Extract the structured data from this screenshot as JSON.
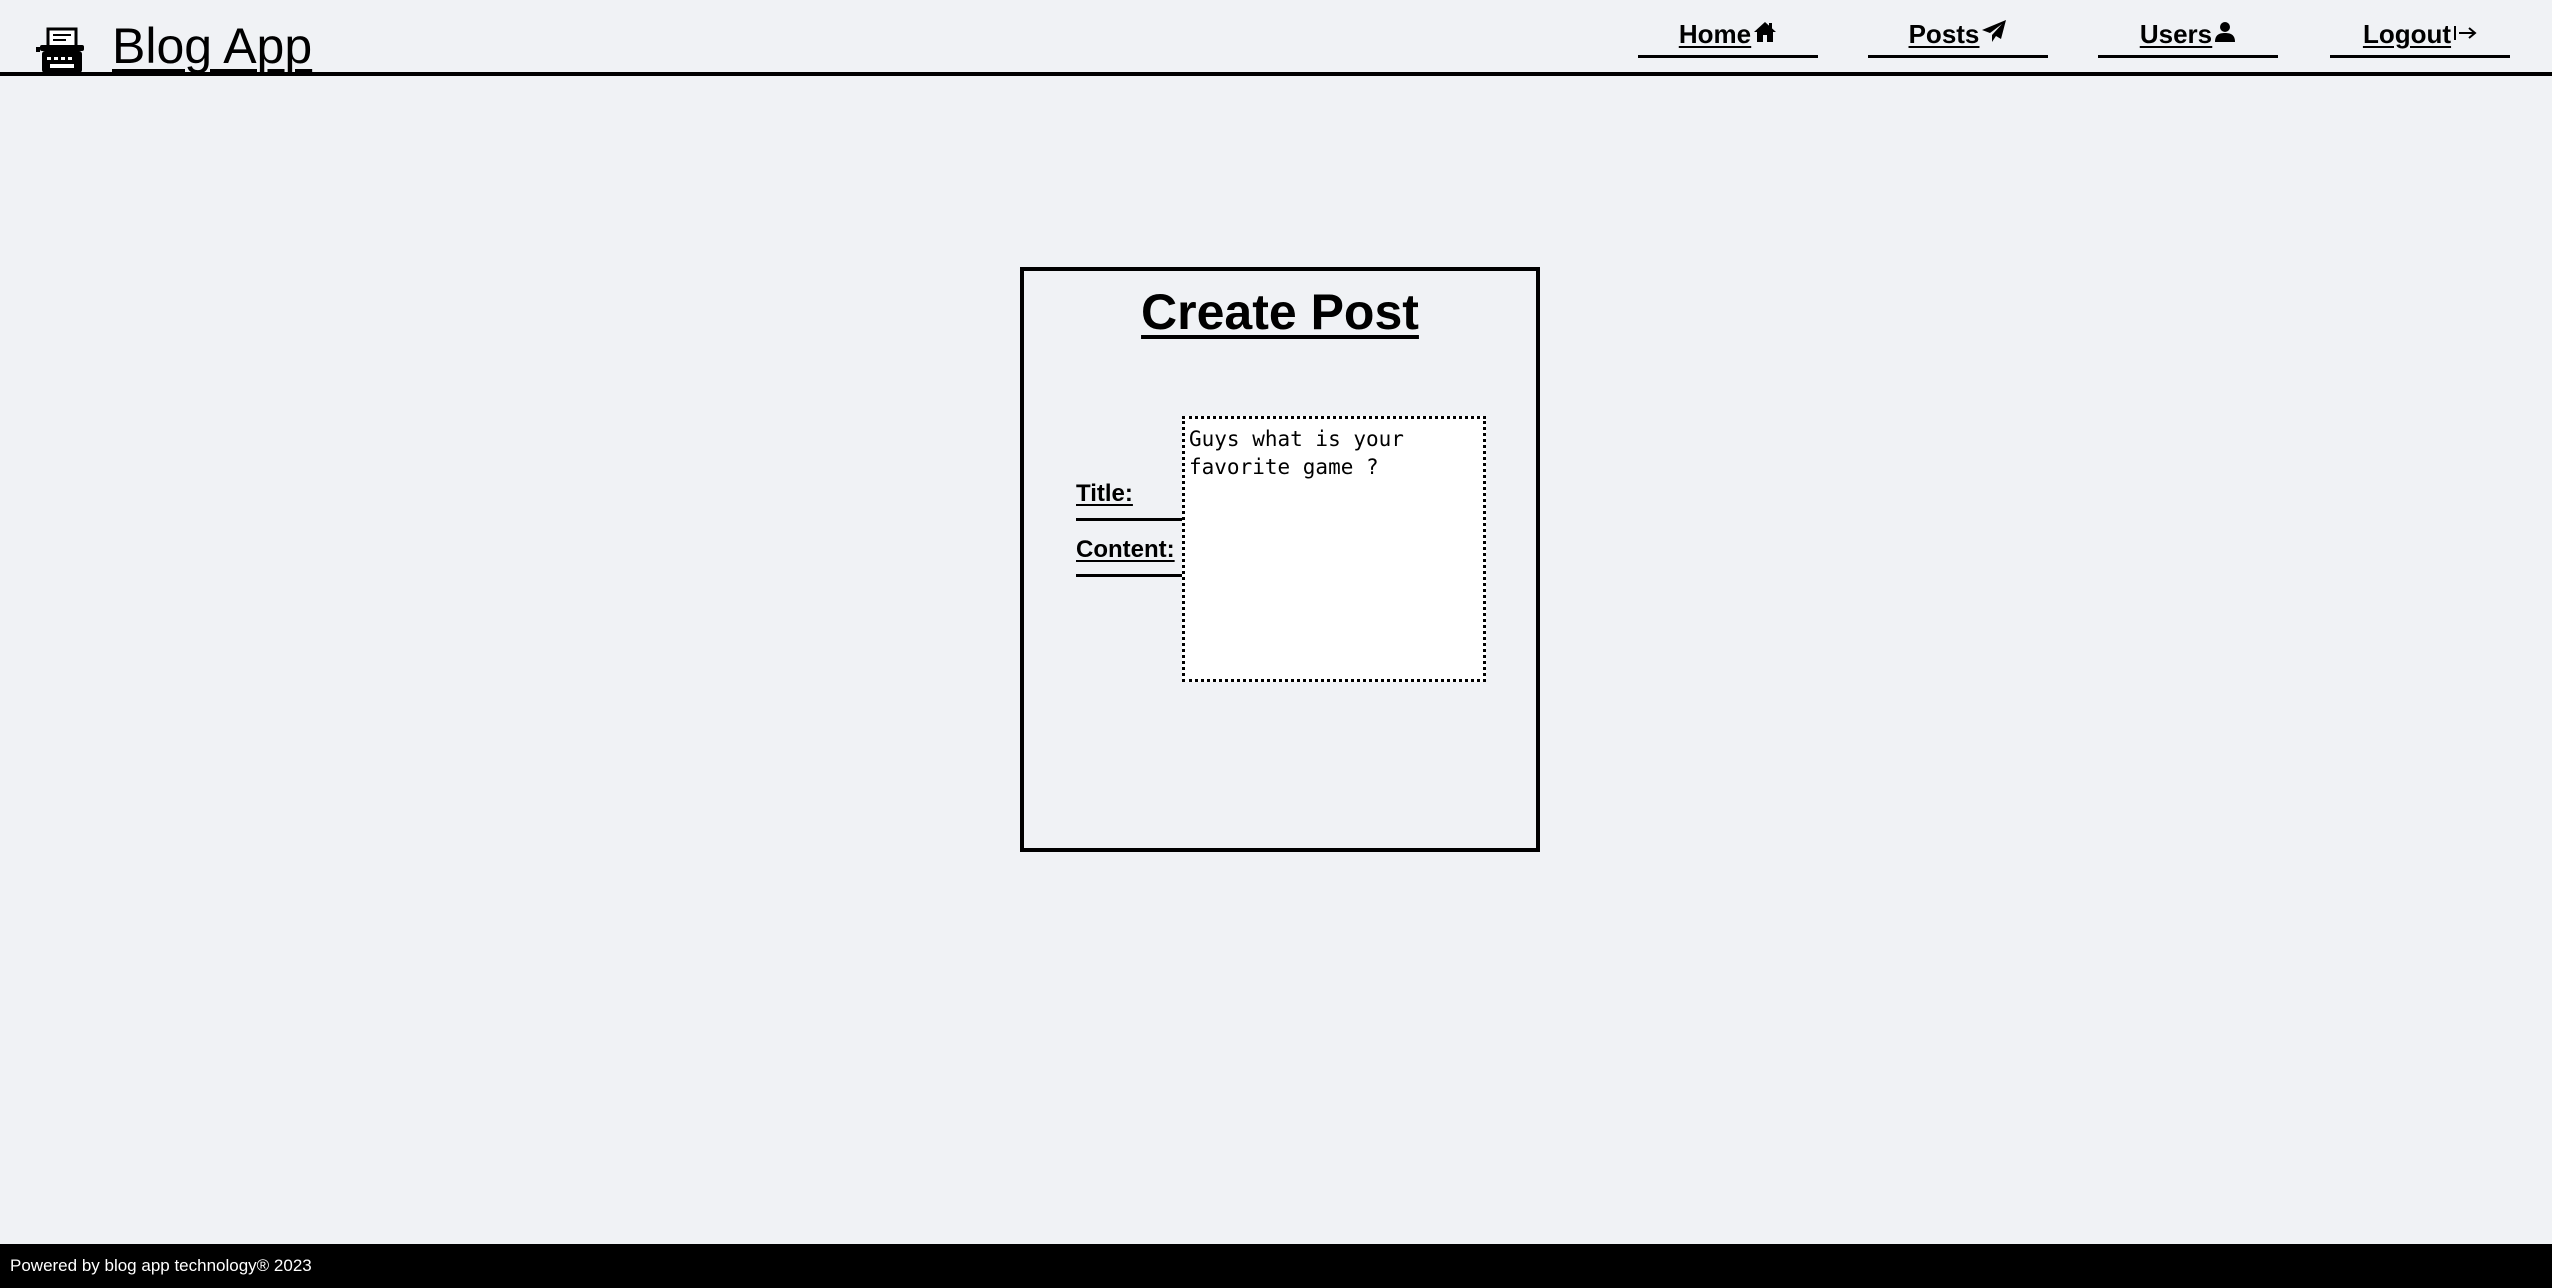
{
  "app": {
    "title": "Blog App",
    "logo_icon": "typewriter-icon"
  },
  "nav": {
    "home": {
      "label": "Home",
      "icon": "home-icon"
    },
    "posts": {
      "label": "Posts",
      "icon": "paper-plane-icon"
    },
    "users": {
      "label": "Users",
      "icon": "user-icon"
    },
    "logout": {
      "label": "Logout",
      "icon": "logout-arrow-icon"
    }
  },
  "form": {
    "heading": "Create Post",
    "title_label": "Title:",
    "content_label": "Content:",
    "content_value": "Guys what is your favorite game ?"
  },
  "footer": {
    "text": "Powered by blog app technology® 2023"
  },
  "colors": {
    "background": "#f0f2f5",
    "text": "#000000",
    "footer_background": "#000000",
    "footer_text": "#ffffff",
    "input_background": "#ffffff"
  }
}
